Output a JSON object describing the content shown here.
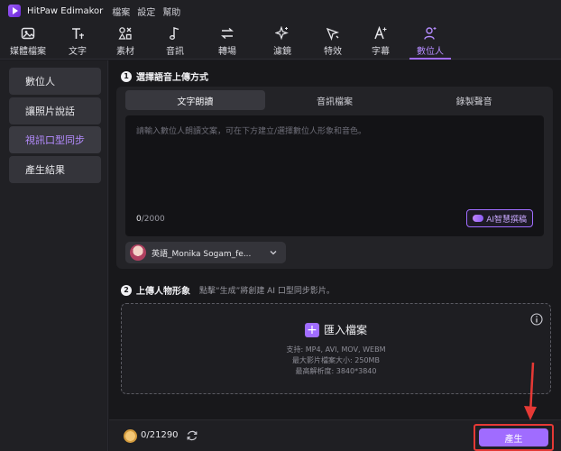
{
  "app": {
    "title": "HitPaw Edimakor",
    "menu": [
      "檔案",
      "設定",
      "幫助"
    ]
  },
  "toolbar": {
    "items": [
      {
        "label": "媒體檔案",
        "icon": "media-icon"
      },
      {
        "label": "文字",
        "icon": "text-icon"
      },
      {
        "label": "素材",
        "icon": "elements-icon"
      },
      {
        "label": "音訊",
        "icon": "audio-icon"
      },
      {
        "label": "轉場",
        "icon": "transition-icon"
      },
      {
        "label": "濾鏡",
        "icon": "filter-icon"
      },
      {
        "label": "特效",
        "icon": "effects-icon"
      },
      {
        "label": "字幕",
        "icon": "subtitle-icon"
      },
      {
        "label": "數位人",
        "icon": "digital-human-icon",
        "active": true
      }
    ]
  },
  "sidebar": {
    "items": [
      {
        "label": "數位人"
      },
      {
        "label": "讓照片說話"
      },
      {
        "label": "視訊口型同步",
        "active": true
      },
      {
        "label": "產生結果"
      }
    ]
  },
  "step1": {
    "number": "1",
    "title": "選擇語音上傳方式",
    "tabs": [
      "文字朗讀",
      "音訊檔案",
      "錄製聲音"
    ],
    "placeholder": "請輸入數位人朗讀文案，可在下方建立/選擇數位人形象和音色。",
    "count_current": "0",
    "count_max": "/2000",
    "ai_button": "AI智慧撰稿",
    "voice": "英語_Monika Sogam_fe..."
  },
  "step2": {
    "number": "2",
    "title": "上傳人物形象",
    "hint": "點擊“生成”將創建 AI 口型同步影片。",
    "upload_label": "匯入檔案",
    "formats": "支持: MP4, AVI, MOV, WEBM",
    "max_size": "最大影片檔案大小: 250MB",
    "max_resolution": "最高解析度: 3840*3840"
  },
  "footer": {
    "credits": "0/21290",
    "generate": "產生"
  },
  "colors": {
    "accent": "#a06cff",
    "highlight_box": "#e53935"
  }
}
